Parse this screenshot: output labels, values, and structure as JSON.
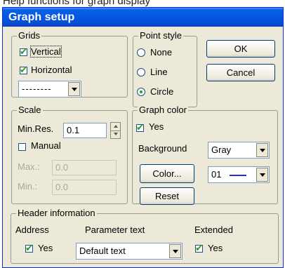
{
  "above_text": "Help functions for graph display",
  "dialog": {
    "title": "Graph setup"
  },
  "grids": {
    "legend": "Grids",
    "vertical_label": "Vertical",
    "vertical_checked": true,
    "horizontal_label": "Horizontal",
    "horizontal_checked": true,
    "line_style_value": "--------"
  },
  "point_style": {
    "legend": "Point style",
    "options": [
      "None",
      "Line",
      "Circle"
    ],
    "selected": "Circle"
  },
  "buttons": {
    "ok": "OK",
    "cancel": "Cancel",
    "color": "Color...",
    "reset": "Reset"
  },
  "scale": {
    "legend": "Scale",
    "min_res_label": "Min.Res.",
    "min_res_value": "0.1",
    "manual_label": "Manual",
    "manual_checked": false,
    "max_label": "Max.:",
    "max_value": "0.0",
    "min_label": "Min.:",
    "min_value": "0.0"
  },
  "graph_color": {
    "legend": "Graph color",
    "yes_label": "Yes",
    "yes_checked": true,
    "background_label": "Background",
    "background_value": "Gray",
    "line_value": "01",
    "line_color": "#2233cc"
  },
  "header_info": {
    "legend": "Header information",
    "address_label": "Address",
    "parameter_label": "Parameter text",
    "extended_label": "Extended",
    "address_yes_label": "Yes",
    "address_checked": true,
    "parameter_value": "Default text",
    "extended_yes_label": "Yes",
    "extended_checked": true
  },
  "colors": {
    "title_bar": "#0456e0",
    "dialog_bg": "#ece9d8",
    "check_mark": "#21a121"
  }
}
